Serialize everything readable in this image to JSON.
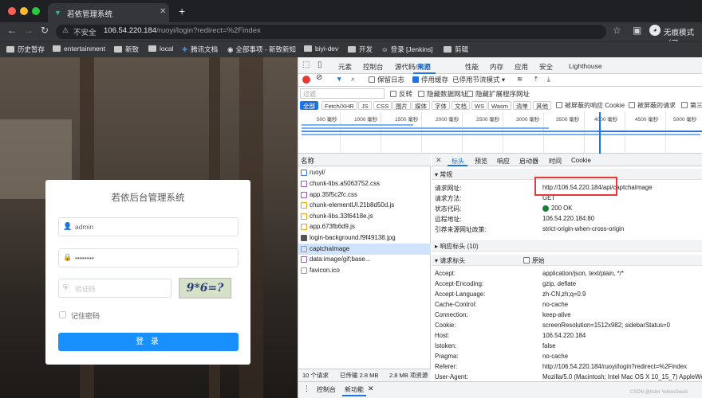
{
  "browser": {
    "tab_title": "若依管理系统",
    "insecure_label": "不安全",
    "url_host": "106.54.220.184",
    "url_path": "/ruoyi/login?redirect=%2Findex",
    "incognito_label": "无痕模式（已",
    "bookmarks": [
      "历史暂存",
      "entertainment",
      "新致",
      "local",
      "腾讯文档",
      "全部事项 - 新致新知",
      "biyi-dev",
      "开发",
      "登录 [Jenkins]",
      "剪辑"
    ]
  },
  "login": {
    "title": "若依后台管理系统",
    "username": "admin",
    "password": "••••••••",
    "captcha_placeholder": "验证码",
    "captcha_image_text": "9*6=?",
    "remember": "记住密码",
    "submit": "登 录"
  },
  "devtools": {
    "tabs": [
      "元素",
      "控制台",
      "源代码/来源",
      "网络",
      "性能",
      "内存",
      "应用",
      "安全",
      "Lighthouse"
    ],
    "toolbar": {
      "preserve_log": "保留日志",
      "disable_cache": "停用缓存",
      "throttle": "已停用节流模式"
    },
    "filter_placeholder": "过滤",
    "filter_opts": [
      "反转",
      "隐藏数据网址",
      "隐藏扩展程序网址"
    ],
    "type_chips": [
      "全部",
      "Fetch/XHR",
      "JS",
      "CSS",
      "图片",
      "媒体",
      "字体",
      "文档",
      "WS",
      "Wasm",
      "清单",
      "其他"
    ],
    "blocked": [
      "被屏蔽的响应 Cookie",
      "被屏蔽的请求",
      "第三"
    ],
    "ticks": [
      "500 毫秒",
      "1000 毫秒",
      "1500 毫秒",
      "2000 毫秒",
      "2500 毫秒",
      "3000 毫秒",
      "3500 毫秒",
      "4000 毫秒",
      "4500 毫秒",
      "5000 毫秒"
    ],
    "name_header": "名称",
    "requests": [
      "ruoyi/",
      "chunk-libs.a5063752.css",
      "app.35f5c2fc.css",
      "chunk-elementUI.21b8d50d.js",
      "chunk-libs.33f6418e.js",
      "app.673fb6d9.js",
      "login-background.f9f49138.jpg",
      "captchaImage",
      "data:image/gif;base...",
      "favicon.ico"
    ],
    "footer": [
      "10 个请求",
      "已传输 2.8 MB",
      "2.8 MB 项资源"
    ],
    "detail_tabs": [
      "标头",
      "预览",
      "响应",
      "启动器",
      "时间",
      "Cookie"
    ],
    "general_title": "常规",
    "general": [
      {
        "k": "请求网址:",
        "v": "http://106.54.220.184/api/captchaImage"
      },
      {
        "k": "请求方法:",
        "v": "GET"
      },
      {
        "k": "状态代码:",
        "v": "200 OK"
      },
      {
        "k": "远程地址:",
        "v": "106.54.220.184:80"
      },
      {
        "k": "引荐来源网址政策:",
        "v": "strict-origin-when-cross-origin"
      }
    ],
    "response_headers": "响应标头 (10)",
    "request_headers": "请求标头",
    "raw": "原始",
    "req_headers": [
      {
        "k": "Accept:",
        "v": "application/json, text/plain, */*"
      },
      {
        "k": "Accept-Encoding:",
        "v": "gzip, deflate"
      },
      {
        "k": "Accept-Language:",
        "v": "zh-CN,zh;q=0.9"
      },
      {
        "k": "Cache-Control:",
        "v": "no-cache"
      },
      {
        "k": "Connection:",
        "v": "keep-alive"
      },
      {
        "k": "Cookie:",
        "v": "screenResolution=1512x982; sidebarStatus=0"
      },
      {
        "k": "Host:",
        "v": "106.54.220.184"
      },
      {
        "k": "Istoken:",
        "v": "false"
      },
      {
        "k": "Pragma:",
        "v": "no-cache"
      },
      {
        "k": "Referer:",
        "v": "http://106.54.220.184/ruoyi/login?redirect=%2Findex"
      },
      {
        "k": "User-Agent:",
        "v": "Mozilla/5.0 (Macintosh; Intel Mac OS X 10_15_7) AppleWe"
      }
    ],
    "drawer": [
      "控制台",
      "新功能"
    ],
    "watermark": "CSDN @Itsbir YellowDavid"
  }
}
